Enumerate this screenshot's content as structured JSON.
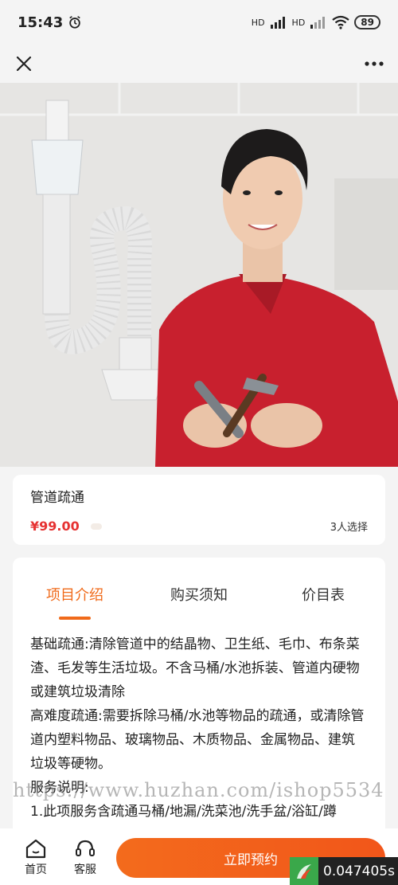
{
  "status_bar": {
    "time": "15:43",
    "signal_label_1": "HD",
    "signal_label_2": "HD",
    "battery": "89"
  },
  "nav": {
    "close_icon": "close-icon",
    "more_icon": "more-icon"
  },
  "product": {
    "title": "管道疏通",
    "price": "¥99.00",
    "selected_count": "3人选择"
  },
  "tabs": [
    {
      "label": "项目介绍",
      "active": true
    },
    {
      "label": "购买须知",
      "active": false
    },
    {
      "label": "价目表",
      "active": false
    }
  ],
  "description": {
    "p1": "基础疏通:清除管道中的结晶物、卫生纸、毛巾、布条菜渣、毛发等生活垃圾。不含马桶/水池拆装、管道内硬物或建筑垃圾清除",
    "p2": "高难度疏通:需要拆除马桶/水池等物品的疏通，或清除管道内塑料物品、玻璃物品、木质物品、金属物品、建筑垃圾等硬物。",
    "p3": "服务说明:",
    "p4": "1.此项服务含疏通马桶/地漏/洗菜池/洗手盆/浴缸/蹲"
  },
  "watermark": "https://www.huzhan.com/ishop5534",
  "bottom_bar": {
    "home_label": "首页",
    "service_label": "客服",
    "book_label": "立即预约"
  },
  "timer": "0.047405s",
  "colors": {
    "accent": "#f06a1a",
    "price": "#e63232",
    "button": "#f2561a"
  }
}
